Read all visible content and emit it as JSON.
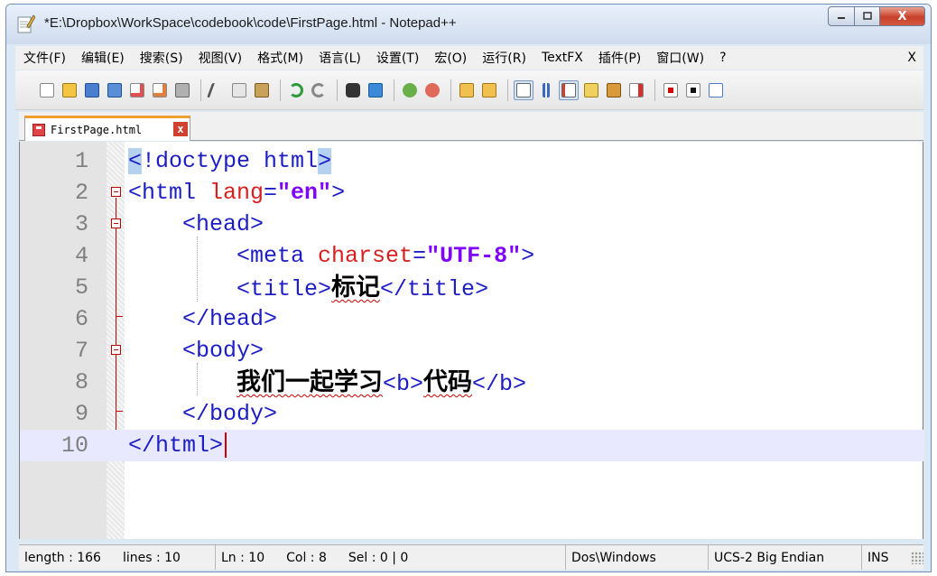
{
  "window": {
    "title": "*E:\\Dropbox\\WorkSpace\\codebook\\code\\FirstPage.html - Notepad++",
    "minimize_label": "—",
    "maximize_label": "□",
    "close_label": "X"
  },
  "menu": {
    "items": [
      "文件(F)",
      "编辑(E)",
      "搜索(S)",
      "视图(V)",
      "格式(M)",
      "语言(L)",
      "设置(T)",
      "宏(O)",
      "运行(R)",
      "TextFX",
      "插件(P)",
      "窗口(W)",
      "?"
    ],
    "close_label": "X"
  },
  "tab": {
    "label": "FirstPage.html",
    "close_label": "x"
  },
  "lines": {
    "n1": "1",
    "n2": "2",
    "n3": "3",
    "n4": "4",
    "n5": "5",
    "n6": "6",
    "n7": "7",
    "n8": "8",
    "n9": "9",
    "n10": "10",
    "l1_lt": "<",
    "l1_mid": "!doctype html",
    "l1_gt": ">",
    "l2_open": "<html ",
    "l2_attr": "lang",
    "l2_eq": "=",
    "l2_val": "\"en\"",
    "l2_close": ">",
    "l3": "    <head>",
    "l4_open": "        <meta ",
    "l4_attr": "charset",
    "l4_eq": "=",
    "l4_val": "\"UTF-8\"",
    "l4_close": ">",
    "l5_open": "        <title>",
    "l5_text": "标记",
    "l5_close": "</title>",
    "l6": "    </head>",
    "l7": "    <body>",
    "l8_pre": "        ",
    "l8_text1": "我们一起学习",
    "l8_b_open": "<b>",
    "l8_text2": "代码",
    "l8_b_close": "</b>",
    "l9": "    </body>",
    "l10": "</html>"
  },
  "status": {
    "length": "length : 166",
    "lines": "lines : 10",
    "ln": "Ln : 10",
    "col": "Col : 8",
    "sel": "Sel : 0 | 0",
    "eol": "Dos\\Windows",
    "encoding": "UCS-2 Big Endian",
    "mode": "INS"
  },
  "toolbar_icons": [
    "new-file-icon",
    "open-file-icon",
    "save-icon",
    "save-all-icon",
    "close-icon",
    "close-all-icon",
    "print-icon",
    "cut-icon",
    "copy-icon",
    "paste-icon",
    "undo-icon",
    "redo-icon",
    "find-icon",
    "replace-icon",
    "zoom-in-icon",
    "zoom-out-icon",
    "sync-vertical-icon",
    "sync-horizontal-icon",
    "word-wrap-icon",
    "show-all-characters-icon",
    "indent-guide-icon",
    "user-defined-language-icon",
    "document-map-icon",
    "function-list-icon",
    "record-macro-icon",
    "stop-recording-icon",
    "playback-macro-icon"
  ]
}
